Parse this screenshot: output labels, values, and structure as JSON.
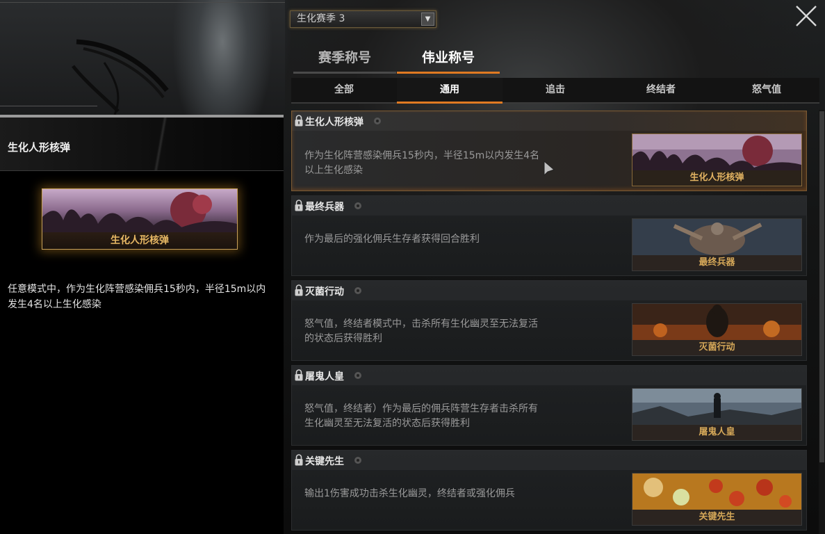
{
  "season_select": {
    "value": "生化赛季 3"
  },
  "main_tabs": [
    {
      "label": "赛季称号",
      "active": false
    },
    {
      "label": "伟业称号",
      "active": true
    }
  ],
  "sub_tabs": [
    {
      "label": "全部",
      "active": false
    },
    {
      "label": "通用",
      "active": true
    },
    {
      "label": "追击",
      "active": false
    },
    {
      "label": "终结者",
      "active": false
    },
    {
      "label": "怒气值",
      "active": false
    }
  ],
  "detail": {
    "title": "生化人形核弹",
    "card_caption": "生化人形核弹",
    "description": "任意模式中，作为生化阵营感染佣兵15秒内，半径15m以内发生4名以上生化感染"
  },
  "achievements": [
    {
      "title": "生化人形核弹",
      "description": "作为生化阵营感染佣兵15秒内，半径15m以内发生4名以上生化感染",
      "badge": "生化人形核弹",
      "selected": true,
      "locked": true
    },
    {
      "title": "最终兵器",
      "description": "作为最后的强化佣兵生存者获得回合胜利",
      "badge": "最终兵器",
      "selected": false,
      "locked": true
    },
    {
      "title": "灭菌行动",
      "description": "怒气值，终结者模式中，击杀所有生化幽灵至无法复活的状态后获得胜利",
      "badge": "灭菌行动",
      "selected": false,
      "locked": true
    },
    {
      "title": "屠鬼人皇",
      "description": "怒气值，终结者）作为最后的佣兵阵营生存者击杀所有生化幽灵至无法复活的状态后获得胜利",
      "badge": "屠鬼人皇",
      "selected": false,
      "locked": true
    },
    {
      "title": "关键先生",
      "description": "输出1伤害成功击杀生化幽灵，终结者或强化佣兵",
      "badge": "关键先生",
      "selected": false,
      "locked": true
    }
  ],
  "colors": {
    "accent": "#e07a22",
    "gold": "#e3b462"
  },
  "icons": {
    "close": "close-icon",
    "lock": "lock-icon",
    "gear": "gear-icon",
    "dropdown": "chevron-down-icon"
  }
}
